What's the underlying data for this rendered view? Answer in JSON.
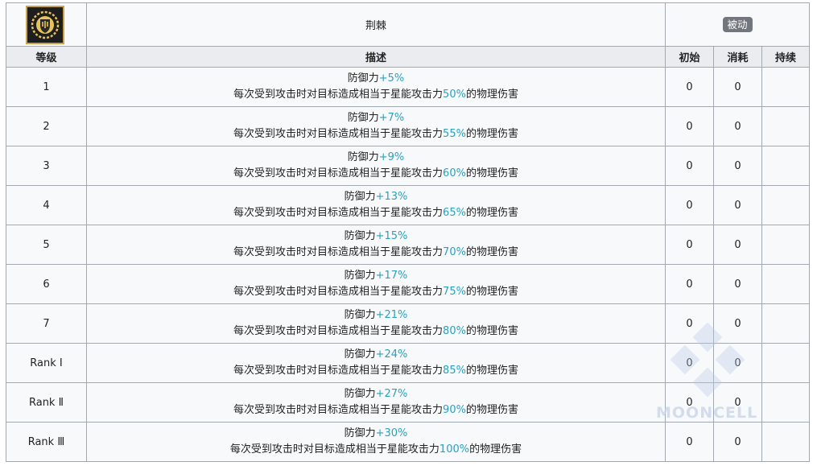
{
  "skill": {
    "icon": "shield-thorns-icon",
    "name": "荆棘",
    "type_badge": "被动"
  },
  "table": {
    "headers": {
      "level": "等级",
      "description": "描述",
      "initial": "初始",
      "cost": "消耗",
      "duration": "持续"
    },
    "rows": [
      {
        "level": "1",
        "line1_prefix": "防御力",
        "line1_value": "+5%",
        "line2_prefix": "每次受到攻击时对目标造成相当于星能攻击力",
        "line2_value": "50%",
        "line2_suffix": "的物理伤害",
        "initial": "0",
        "cost": "0",
        "duration": ""
      },
      {
        "level": "2",
        "line1_prefix": "防御力",
        "line1_value": "+7%",
        "line2_prefix": "每次受到攻击时对目标造成相当于星能攻击力",
        "line2_value": "55%",
        "line2_suffix": "的物理伤害",
        "initial": "0",
        "cost": "0",
        "duration": ""
      },
      {
        "level": "3",
        "line1_prefix": "防御力",
        "line1_value": "+9%",
        "line2_prefix": "每次受到攻击时对目标造成相当于星能攻击力",
        "line2_value": "60%",
        "line2_suffix": "的物理伤害",
        "initial": "0",
        "cost": "0",
        "duration": ""
      },
      {
        "level": "4",
        "line1_prefix": "防御力",
        "line1_value": "+13%",
        "line2_prefix": "每次受到攻击时对目标造成相当于星能攻击力",
        "line2_value": "65%",
        "line2_suffix": "的物理伤害",
        "initial": "0",
        "cost": "0",
        "duration": ""
      },
      {
        "level": "5",
        "line1_prefix": "防御力",
        "line1_value": "+15%",
        "line2_prefix": "每次受到攻击时对目标造成相当于星能攻击力",
        "line2_value": "70%",
        "line2_suffix": "的物理伤害",
        "initial": "0",
        "cost": "0",
        "duration": ""
      },
      {
        "level": "6",
        "line1_prefix": "防御力",
        "line1_value": "+17%",
        "line2_prefix": "每次受到攻击时对目标造成相当于星能攻击力",
        "line2_value": "75%",
        "line2_suffix": "的物理伤害",
        "initial": "0",
        "cost": "0",
        "duration": ""
      },
      {
        "level": "7",
        "line1_prefix": "防御力",
        "line1_value": "+21%",
        "line2_prefix": "每次受到攻击时对目标造成相当于星能攻击力",
        "line2_value": "80%",
        "line2_suffix": "的物理伤害",
        "initial": "0",
        "cost": "0",
        "duration": ""
      },
      {
        "level": "Rank Ⅰ",
        "line1_prefix": "防御力",
        "line1_value": "+24%",
        "line2_prefix": "每次受到攻击时对目标造成相当于星能攻击力",
        "line2_value": "85%",
        "line2_suffix": "的物理伤害",
        "initial": "0",
        "cost": "0",
        "duration": ""
      },
      {
        "level": "Rank Ⅱ",
        "line1_prefix": "防御力",
        "line1_value": "+27%",
        "line2_prefix": "每次受到攻击时对目标造成相当于星能攻击力",
        "line2_value": "90%",
        "line2_suffix": "的物理伤害",
        "initial": "0",
        "cost": "0",
        "duration": ""
      },
      {
        "level": "Rank Ⅲ",
        "line1_prefix": "防御力",
        "line1_value": "+30%",
        "line2_prefix": "每次受到攻击时对目标造成相当于星能攻击力",
        "line2_value": "100%",
        "line2_suffix": "的物理伤害",
        "initial": "0",
        "cost": "0",
        "duration": ""
      }
    ]
  },
  "watermark": {
    "text": "MOONCELL",
    "icon": "mooncell-logo-icon"
  },
  "colors": {
    "highlight": "#2b9fbe",
    "border": "#a2a9b1",
    "header_bg": "#eaecf0",
    "cell_bg": "#f8f9fa",
    "badge_bg": "#72777d",
    "icon_gold": "#c8a24a"
  }
}
